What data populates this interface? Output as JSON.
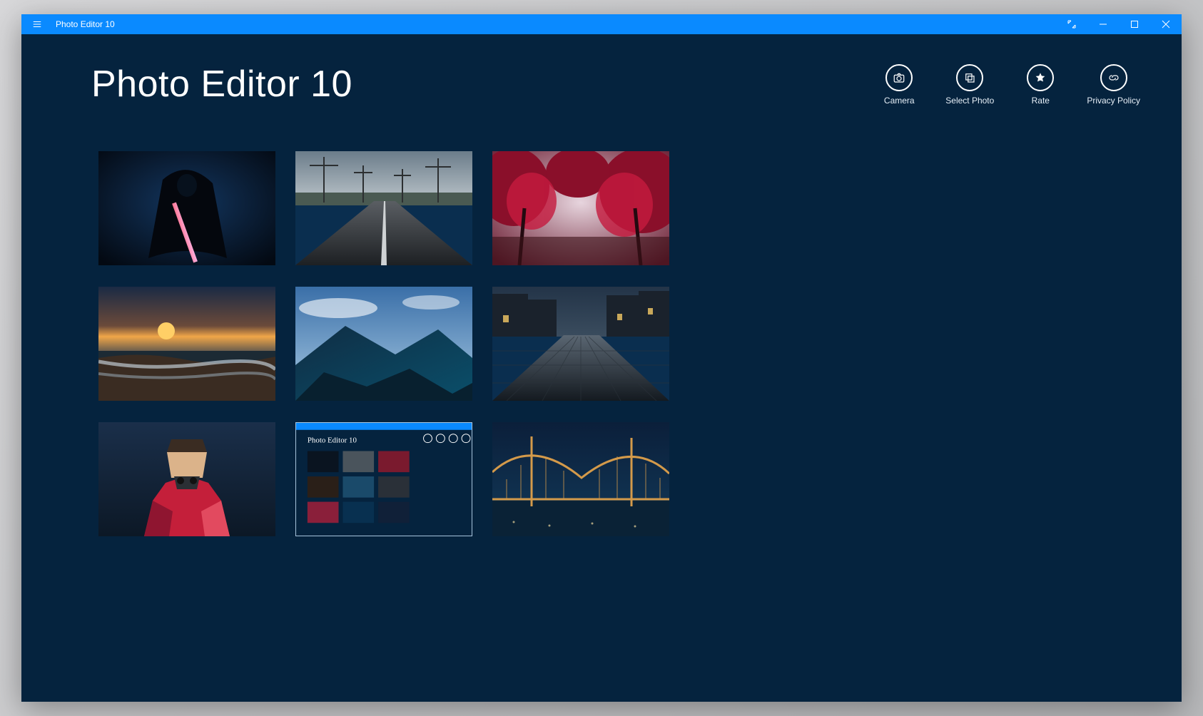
{
  "window": {
    "title": "Photo Editor 10"
  },
  "header": {
    "app_title": "Photo Editor 10"
  },
  "actions": {
    "camera": "Camera",
    "select_photo": "Select Photo",
    "rate": "Rate",
    "privacy_policy": "Privacy Policy"
  },
  "thumbnails": [
    {
      "name": "dark-figure-lightsaber"
    },
    {
      "name": "road-powerlines"
    },
    {
      "name": "red-autumn-trees"
    },
    {
      "name": "beach-sunset"
    },
    {
      "name": "mountain-ridge"
    },
    {
      "name": "cobblestone-street"
    },
    {
      "name": "polygon-mask-portrait"
    },
    {
      "name": "app-screenshot"
    },
    {
      "name": "golden-gate-bridge-night"
    }
  ],
  "appshot": {
    "inner_title": "Photo Editor 10"
  }
}
